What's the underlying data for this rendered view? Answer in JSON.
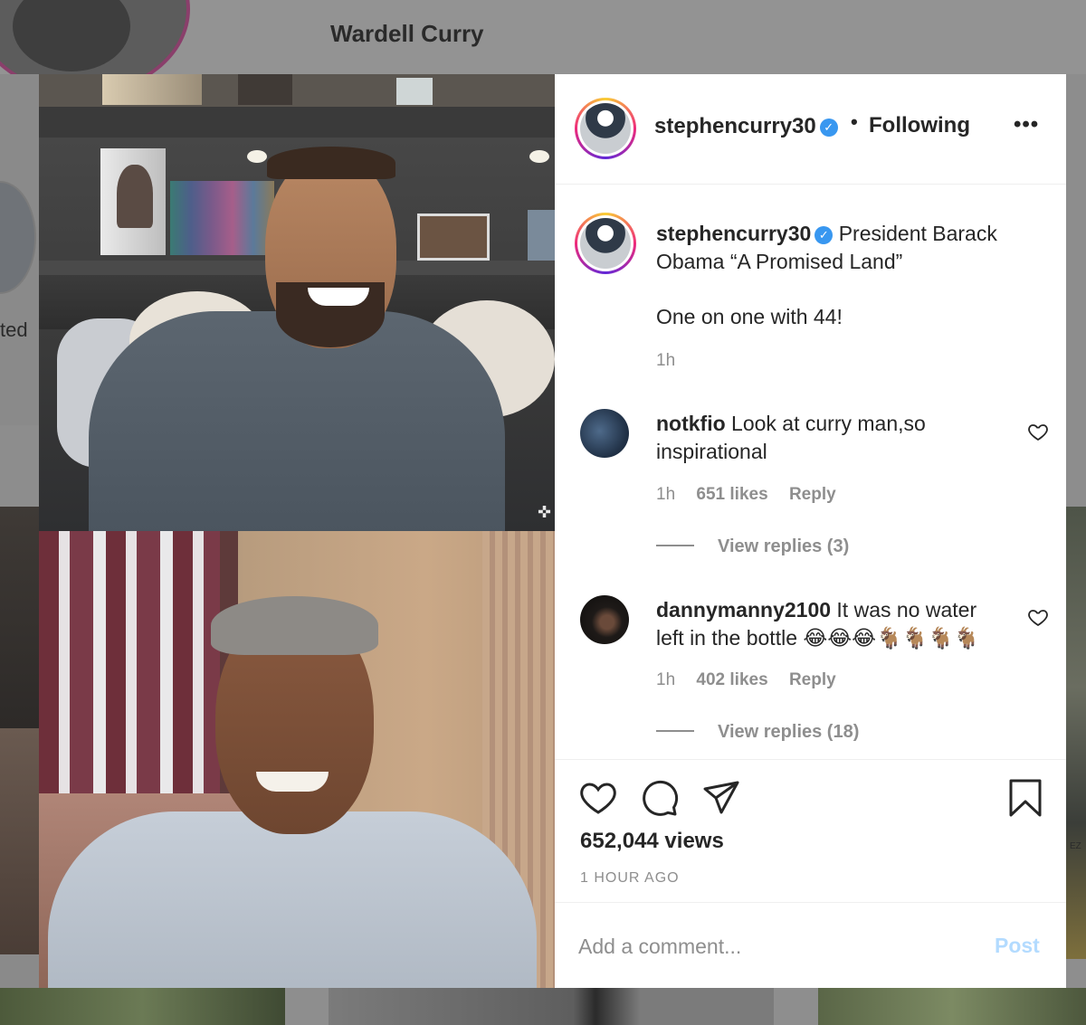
{
  "background": {
    "profile_name": "Wardell Curry",
    "left_partial_text": "ted",
    "right_partial_label": "EZ"
  },
  "post": {
    "header": {
      "username": "stephencurry30",
      "verified": true,
      "dot": "•",
      "follow_status": "Following",
      "more_icon": "more-horizontal-icon"
    },
    "caption": {
      "username": "stephencurry30",
      "text_line1": "President Barack",
      "text_line2": "Obama “A Promised Land”",
      "text_line3": "One on one with 44!",
      "time": "1h"
    },
    "comments": [
      {
        "username": "notkfio",
        "text_line1": "Look at curry man,so",
        "text_line2": "inspirational",
        "time": "1h",
        "likes": "651 likes",
        "reply_label": "Reply",
        "view_replies": "View replies (3)"
      },
      {
        "username": "dannymanny2100",
        "text_line1": "It was no water",
        "text_line2": "left in the bottle 😂😂😂🐐🐐🐐🐐",
        "time": "1h",
        "likes": "402 likes",
        "reply_label": "Reply",
        "view_replies": "View replies (18)"
      }
    ],
    "actions": {
      "like_icon": "heart-icon",
      "comment_icon": "comment-bubble-icon",
      "share_icon": "paper-plane-icon",
      "save_icon": "bookmark-icon"
    },
    "views": "652,044 views",
    "time_ago": "1 HOUR AGO",
    "comment_box": {
      "placeholder": "Add a comment...",
      "post_label": "Post"
    }
  },
  "colors": {
    "verified_blue": "#3897f0",
    "muted_text": "#8e8e8e",
    "post_button_disabled": "#b3dbff",
    "text": "#262626"
  }
}
